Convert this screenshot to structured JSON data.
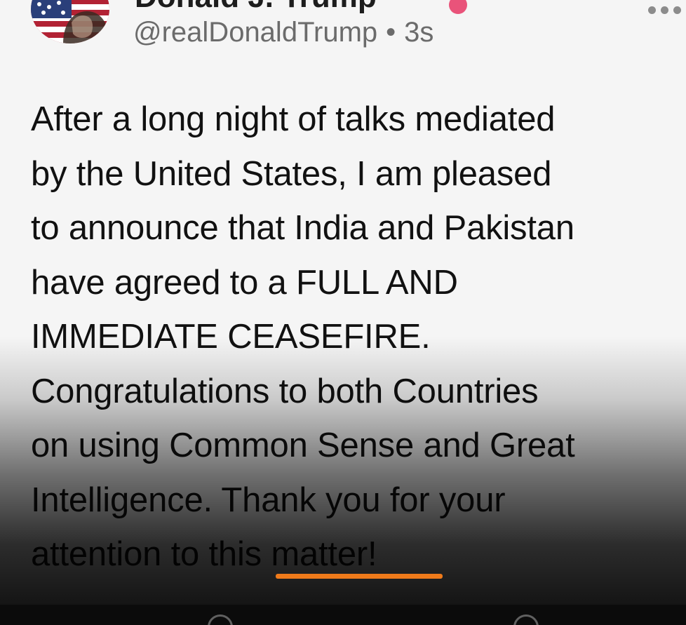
{
  "profile": {
    "display_name": "Donald J. Trump",
    "handle": "@realDonaldTrump",
    "separator": "•",
    "timestamp": "3s",
    "avatar_icon": "avatar-flag-portrait-icon",
    "verified_icon": "verified-badge-icon",
    "more_icon": "more-horizontal-icon"
  },
  "post": {
    "lines": [
      "After a long night of talks mediated",
      "by the United States, I am pleased",
      "to announce that India and Pakistan",
      "have agreed to a FULL AND",
      "IMMEDIATE CEASEFIRE.",
      "Congratulations to both Countries",
      "on using Common Sense and Great",
      "Intelligence. Thank you for your",
      "attention to this matter!"
    ]
  },
  "colors": {
    "accent_underline": "#ef7a1a",
    "verified_badge": "#e9537a",
    "text": "#111111",
    "meta_text": "#6b6b6b",
    "background": "#f5f5f5"
  }
}
